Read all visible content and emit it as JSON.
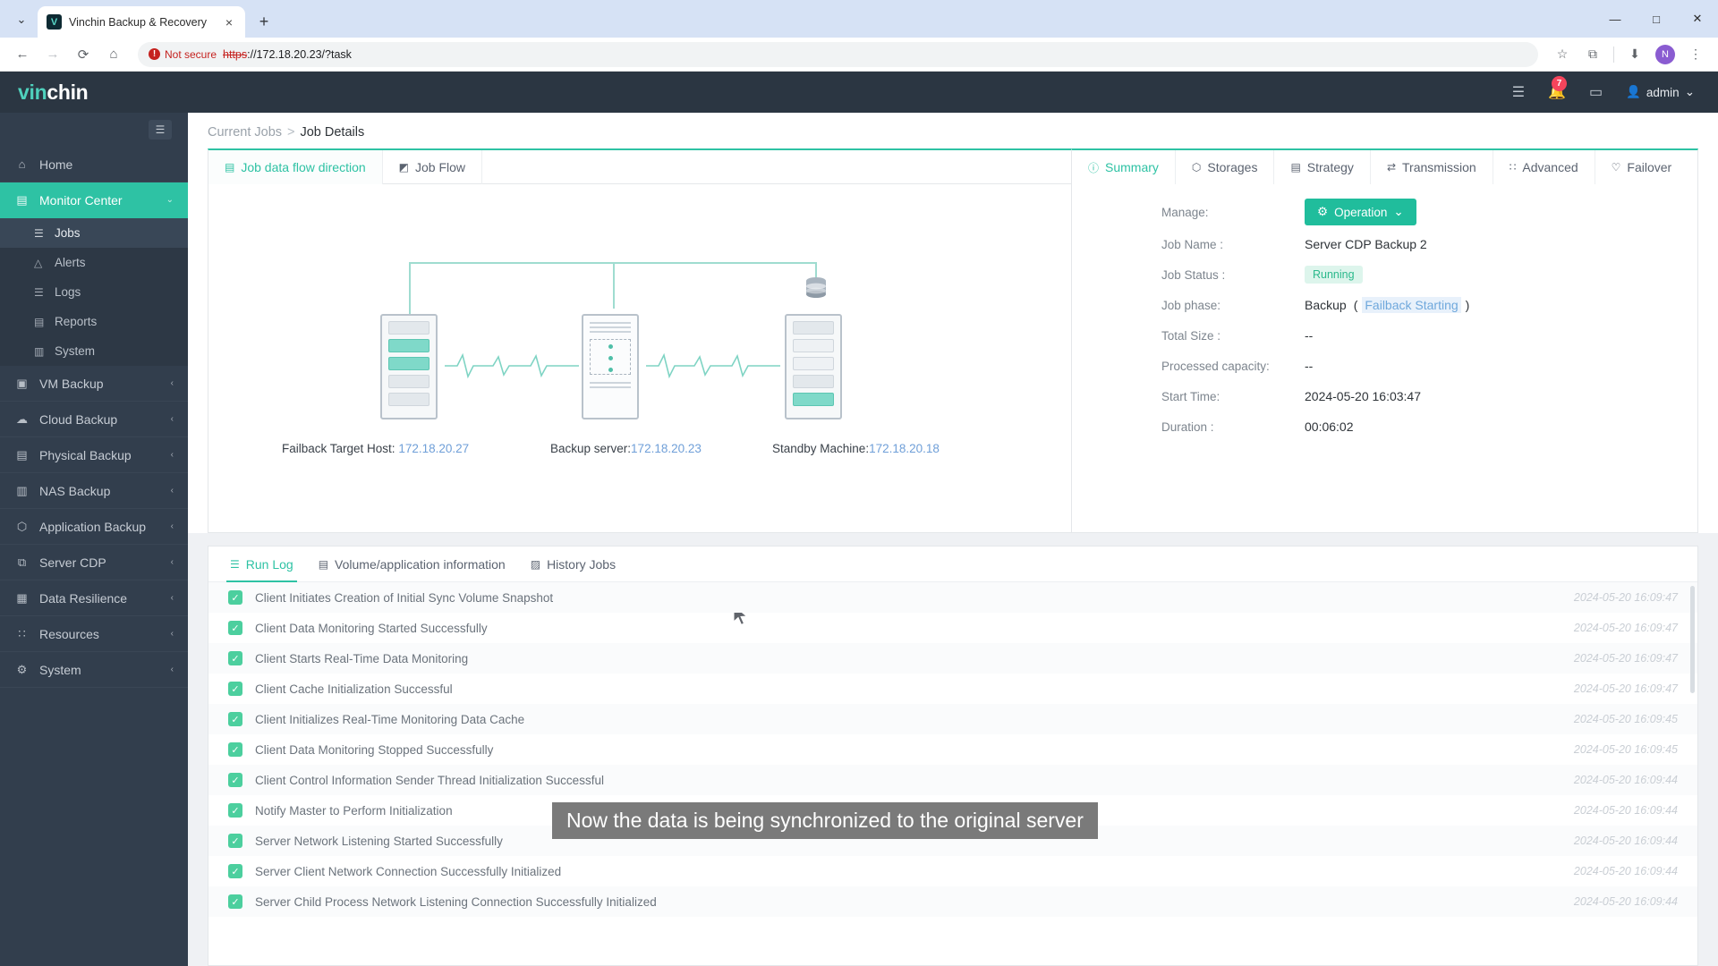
{
  "browser": {
    "tab_title": "Vinchin Backup & Recovery",
    "favicon_letter": "V",
    "new_tab_label": "+",
    "close_label": "×",
    "chevron_label": "⌄",
    "window_minimize": "—",
    "window_maximize": "□",
    "window_close": "✕",
    "nav_back": "←",
    "nav_forward": "→",
    "nav_reload": "⟳",
    "nav_home": "⌂",
    "security_label": "Not secure",
    "security_glyph": "!",
    "url_scheme": "https",
    "url_rest": "://172.18.20.23/?task",
    "bookmark_icon": "☆",
    "extensions_icon": "⧉",
    "download_icon": "⬇",
    "profile_letter": "N",
    "menu_icon": "⋮"
  },
  "header": {
    "logo_first": "vin",
    "logo_second": "chin",
    "icons": [
      {
        "name": "document-icon",
        "glyph": "☰"
      },
      {
        "name": "bell-icon",
        "glyph": "🔔",
        "badge": "7"
      },
      {
        "name": "monitor-icon",
        "glyph": "▭"
      }
    ],
    "user_glyph": "👤",
    "user_name": "admin",
    "user_caret": "⌄"
  },
  "sidebar": {
    "collapse_glyph": "☰",
    "items": [
      {
        "label": "Home",
        "icon": "home-icon",
        "glyph": "⌂",
        "arrow": "",
        "active": false
      },
      {
        "label": "Monitor Center",
        "icon": "monitor-center-icon",
        "glyph": "▤",
        "arrow": "⌄",
        "active": true
      },
      {
        "label": "VM Backup",
        "icon": "vm-backup-icon",
        "glyph": "▣",
        "arrow": "‹",
        "active": false
      },
      {
        "label": "Cloud Backup",
        "icon": "cloud-backup-icon",
        "glyph": "☁",
        "arrow": "‹",
        "active": false
      },
      {
        "label": "Physical Backup",
        "icon": "physical-backup-icon",
        "glyph": "▤",
        "arrow": "‹",
        "active": false
      },
      {
        "label": "NAS Backup",
        "icon": "nas-backup-icon",
        "glyph": "▥",
        "arrow": "‹",
        "active": false
      },
      {
        "label": "Application Backup",
        "icon": "application-backup-icon",
        "glyph": "⬡",
        "arrow": "‹",
        "active": false
      },
      {
        "label": "Server CDP",
        "icon": "server-cdp-icon",
        "glyph": "⧉",
        "arrow": "‹",
        "active": false
      },
      {
        "label": "Data Resilience",
        "icon": "data-resilience-icon",
        "glyph": "▦",
        "arrow": "‹",
        "active": false
      },
      {
        "label": "Resources",
        "icon": "resources-icon",
        "glyph": "∷",
        "arrow": "‹",
        "active": false
      },
      {
        "label": "System",
        "icon": "system-settings-icon",
        "glyph": "⚙",
        "arrow": "‹",
        "active": false
      }
    ],
    "sub_items": [
      {
        "label": "Jobs",
        "glyph": "☰",
        "current": true
      },
      {
        "label": "Alerts",
        "glyph": "△",
        "current": false
      },
      {
        "label": "Logs",
        "glyph": "☰",
        "current": false
      },
      {
        "label": "Reports",
        "glyph": "▤",
        "current": false
      },
      {
        "label": "System",
        "glyph": "▥",
        "current": false
      }
    ]
  },
  "breadcrumb": {
    "parent": "Current Jobs",
    "separator": ">",
    "current": "Job Details"
  },
  "left_panel": {
    "tabs": [
      {
        "label": "Job data flow direction",
        "glyph": "▤",
        "active": true
      },
      {
        "label": "Job Flow",
        "glyph": "◩",
        "active": false
      }
    ],
    "nodes": [
      {
        "label_prefix": "Failback Target Host: ",
        "ip": "172.18.20.27"
      },
      {
        "label_prefix": "Backup server:",
        "ip": "172.18.20.23"
      },
      {
        "label_prefix": "Standby Machine:",
        "ip": "172.18.20.18"
      }
    ]
  },
  "right_panel": {
    "tabs": [
      {
        "label": "Summary",
        "glyph": "ⓘ",
        "active": true
      },
      {
        "label": "Storages",
        "glyph": "⬡",
        "active": false
      },
      {
        "label": "Strategy",
        "glyph": "▤",
        "active": false
      },
      {
        "label": "Transmission",
        "glyph": "⇄",
        "active": false
      },
      {
        "label": "Advanced",
        "glyph": "∷",
        "active": false
      },
      {
        "label": "Failover",
        "glyph": "♡",
        "active": false
      }
    ],
    "manage_label": "Manage:",
    "operation_button": "Operation",
    "operation_glyph": "⚙",
    "operation_caret": "⌄",
    "details": [
      {
        "label": "Job Name :",
        "value": "Server CDP Backup 2",
        "type": "text"
      },
      {
        "label": "Job Status :",
        "value": "Running",
        "type": "pill"
      },
      {
        "label": "Job phase:",
        "value": "Backup",
        "extra_open": "(",
        "extra_link": "Failback Starting",
        "extra_close": ")",
        "type": "phase"
      },
      {
        "label": "Total Size :",
        "value": "--",
        "type": "text"
      },
      {
        "label": "Processed capacity:",
        "value": "--",
        "type": "text"
      },
      {
        "label": "Start Time:",
        "value": "2024-05-20 16:03:47",
        "type": "text"
      },
      {
        "label": "Duration :",
        "value": "00:06:02",
        "type": "text"
      }
    ]
  },
  "lower_panel": {
    "tabs": [
      {
        "label": "Run Log",
        "glyph": "☰",
        "active": true
      },
      {
        "label": "Volume/application information",
        "glyph": "▤",
        "active": false
      },
      {
        "label": "History Jobs",
        "glyph": "▨",
        "active": false
      }
    ],
    "check_glyph": "✓",
    "rows": [
      {
        "message": "Client Initiates Creation of Initial Sync Volume Snapshot",
        "time": "2024-05-20 16:09:47"
      },
      {
        "message": "Client Data Monitoring Started Successfully",
        "time": "2024-05-20 16:09:47"
      },
      {
        "message": "Client Starts Real-Time Data Monitoring",
        "time": "2024-05-20 16:09:47"
      },
      {
        "message": "Client Cache Initialization Successful",
        "time": "2024-05-20 16:09:47"
      },
      {
        "message": "Client Initializes Real-Time Monitoring Data Cache",
        "time": "2024-05-20 16:09:45"
      },
      {
        "message": "Client Data Monitoring Stopped Successfully",
        "time": "2024-05-20 16:09:45"
      },
      {
        "message": "Client Control Information Sender Thread Initialization Successful",
        "time": "2024-05-20 16:09:44"
      },
      {
        "message": "Notify Master to Perform Initialization",
        "time": "2024-05-20 16:09:44"
      },
      {
        "message": "Server Network Listening Started Successfully",
        "time": "2024-05-20 16:09:44"
      },
      {
        "message": "Server Client Network Connection Successfully Initialized",
        "time": "2024-05-20 16:09:44"
      },
      {
        "message": "Server Child Process Network Listening Connection Successfully Initialized",
        "time": "2024-05-20 16:09:44"
      }
    ]
  },
  "overlay": {
    "subtitle": "Now the data is being synchronized to the original server"
  },
  "colors": {
    "accent_teal": "#2ec2a4",
    "sidebar_bg": "#323e4d",
    "header_bg": "#2b3642",
    "badge_red": "#f5455c",
    "link_blue": "#6f9fd8"
  }
}
